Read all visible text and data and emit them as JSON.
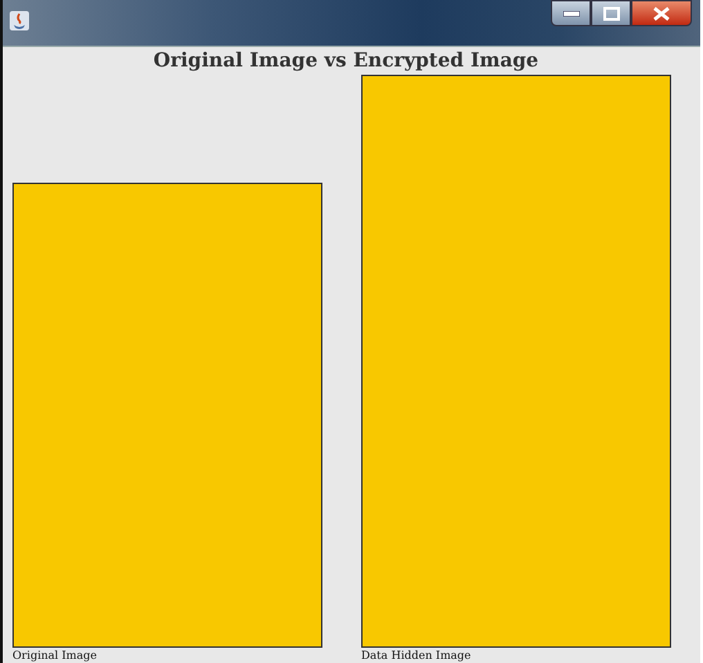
{
  "chart": {
    "title": "Original Image vs Encrypted Image",
    "bars": [
      {
        "label": "Original Image"
      },
      {
        "label": "Data Hidden Image"
      }
    ]
  }
}
